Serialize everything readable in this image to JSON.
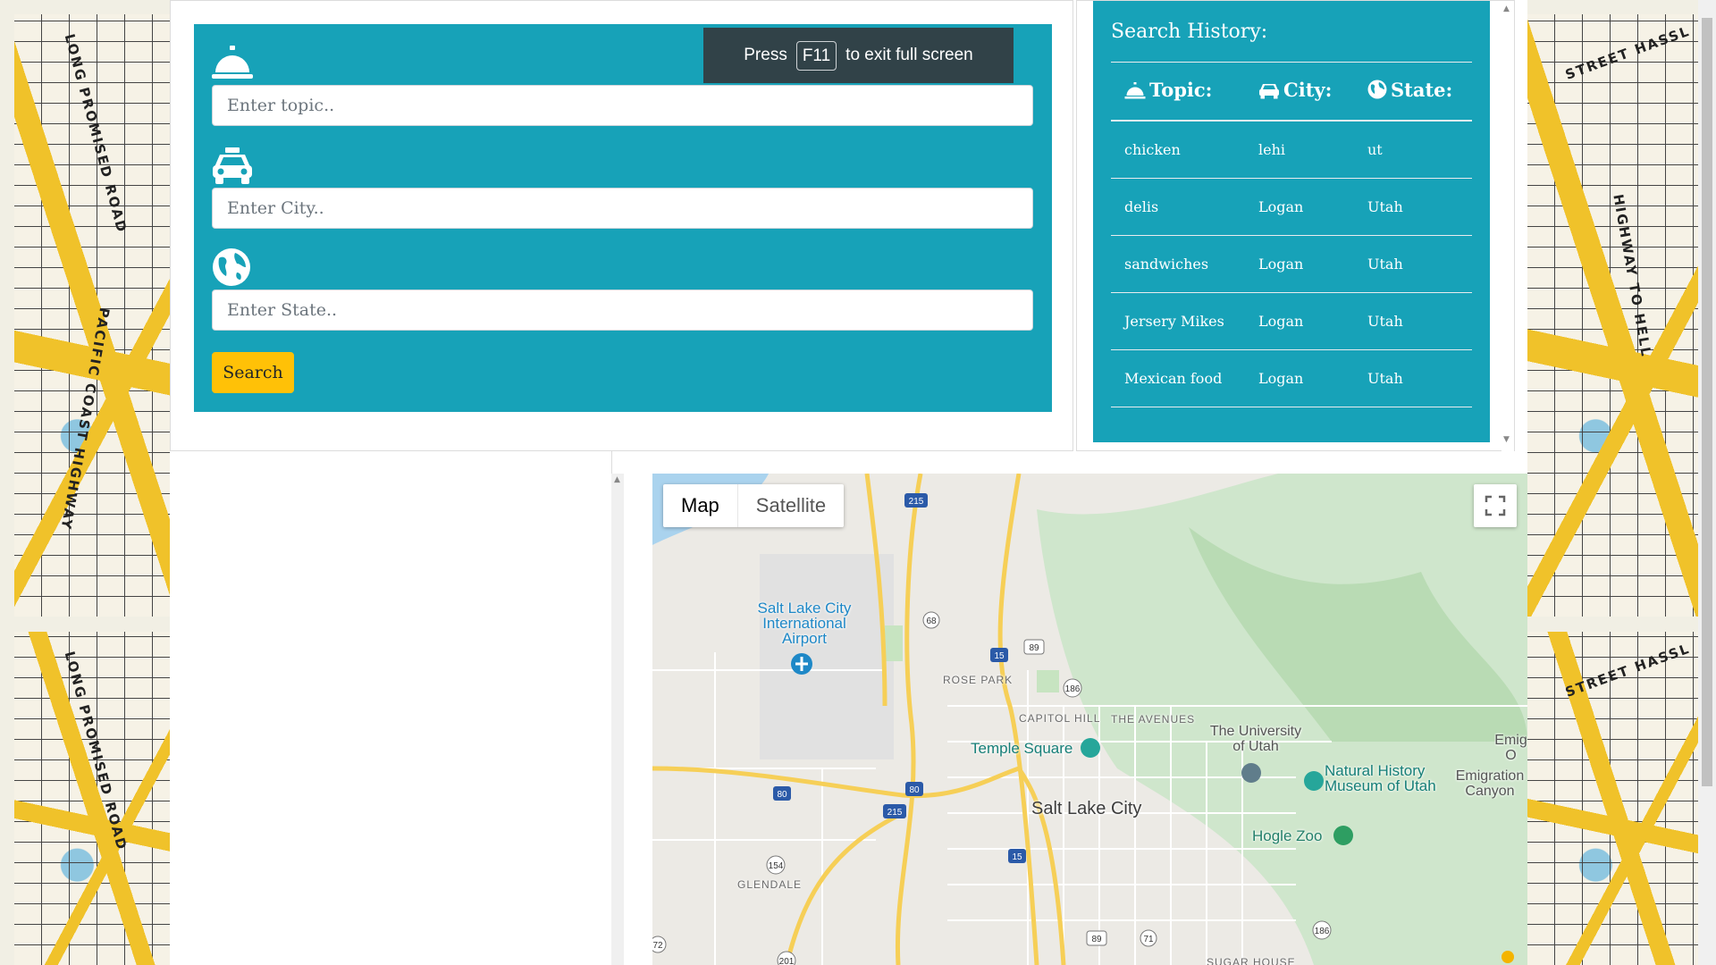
{
  "toast": {
    "press": "Press",
    "key": "F11",
    "message": "to exit full screen"
  },
  "form": {
    "topic_placeholder": "Enter topic..",
    "city_placeholder": "Enter City..",
    "state_placeholder": "Enter State..",
    "search_label": "Search",
    "icons": {
      "topic": "service-bell-icon",
      "city": "taxi-icon",
      "state": "globe-icon"
    }
  },
  "history": {
    "title": "Search History:",
    "headers": {
      "topic": "Topic:",
      "city": "City:",
      "state": "State:"
    },
    "rows": [
      {
        "topic": "chicken",
        "city": "lehi",
        "state": "ut"
      },
      {
        "topic": "delis",
        "city": "Logan",
        "state": "Utah"
      },
      {
        "topic": "sandwiches",
        "city": "Logan",
        "state": "Utah"
      },
      {
        "topic": "Jersery Mikes",
        "city": "Logan",
        "state": "Utah"
      },
      {
        "topic": "Mexican food",
        "city": "Logan",
        "state": "Utah"
      }
    ]
  },
  "map": {
    "type_map": "Map",
    "type_satellite": "Satellite",
    "labels": {
      "airport": "Salt Lake City International Airport",
      "rose_park": "ROSE PARK",
      "capitol_hill": "CAPITOL HILL",
      "the_avenues": "THE AVENUES",
      "university": "The University of Utah",
      "temple_square": "Temple Square",
      "natural_history": "Natural History Museum of Utah",
      "emigration": "Emigration Canyon",
      "emig": "Emig O",
      "salt_lake_city": "Salt Lake City",
      "hogle_zoo": "Hogle Zoo",
      "glendale": "GLENDALE",
      "sugar_house": "SUGAR HOUSE"
    },
    "shields": [
      "215",
      "68",
      "15",
      "89",
      "186",
      "80",
      "80",
      "215",
      "15",
      "154",
      "89",
      "71",
      "186",
      "201",
      "72"
    ]
  },
  "background_map_text": [
    "LONG PROMISED ROAD",
    "PACIFIC COAST HIGHWAY",
    "HIGHWAY TO HELL",
    "STREET HASSL"
  ]
}
